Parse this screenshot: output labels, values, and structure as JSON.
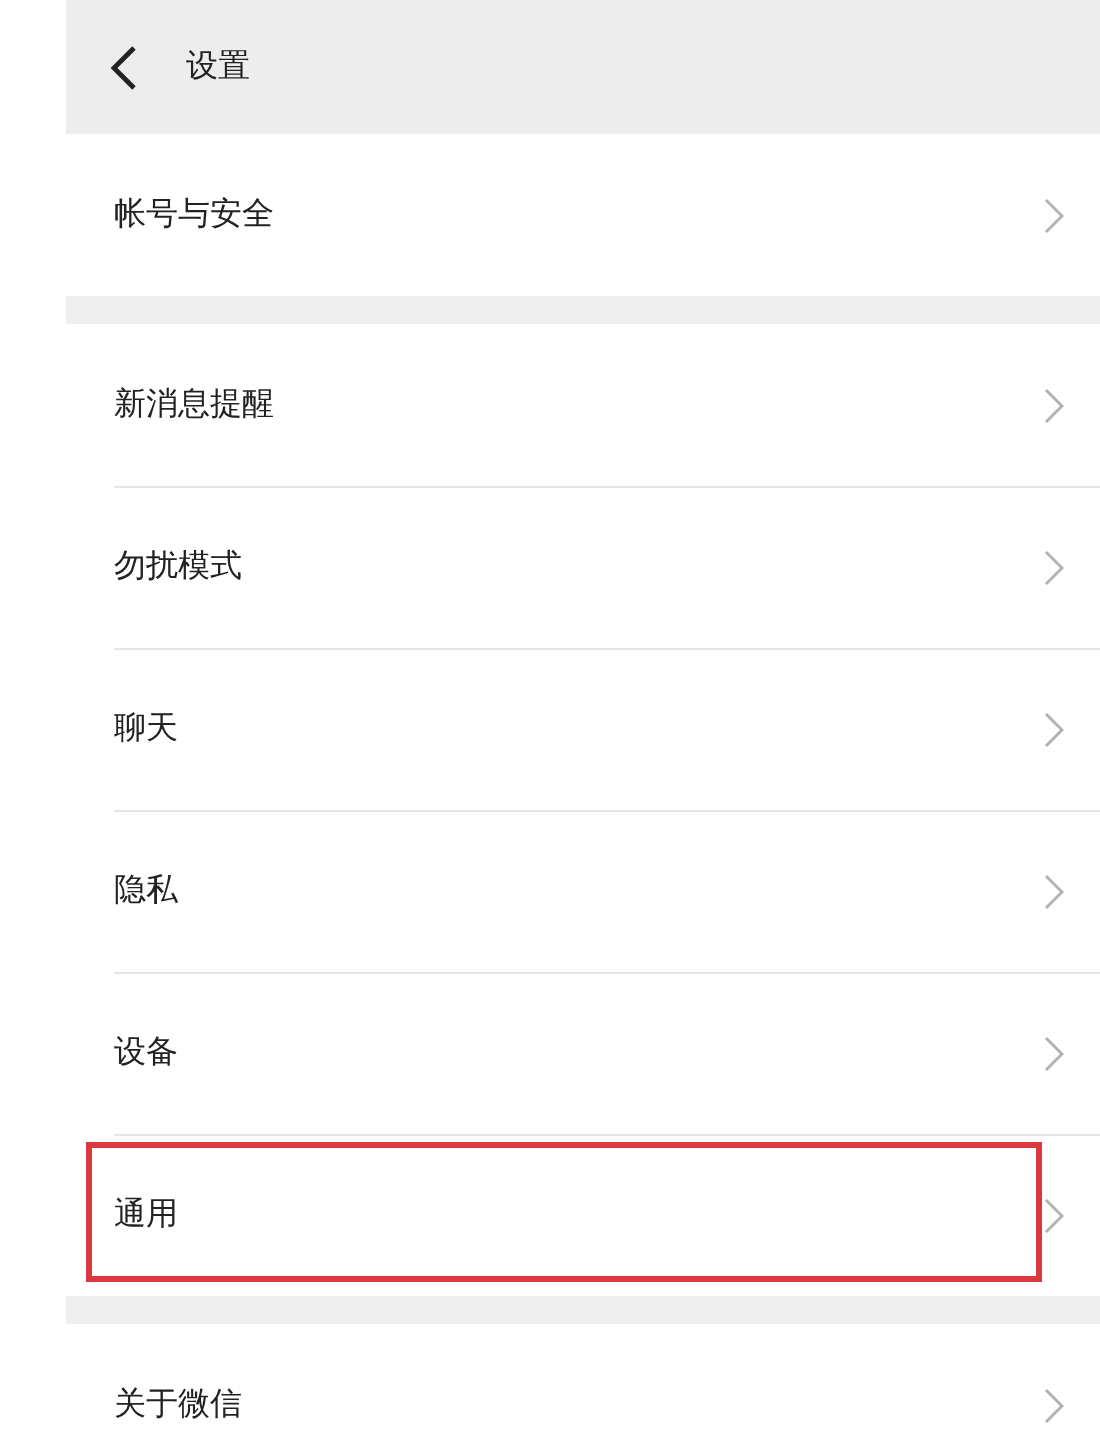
{
  "header": {
    "title": "设置"
  },
  "groups": [
    {
      "items": [
        {
          "label": "帐号与安全",
          "highlighted": false
        }
      ]
    },
    {
      "items": [
        {
          "label": "新消息提醒",
          "highlighted": false
        },
        {
          "label": "勿扰模式",
          "highlighted": false
        },
        {
          "label": "聊天",
          "highlighted": false
        },
        {
          "label": "隐私",
          "highlighted": false
        },
        {
          "label": "设备",
          "highlighted": false
        },
        {
          "label": "通用",
          "highlighted": true
        }
      ]
    },
    {
      "items": [
        {
          "label": "关于微信",
          "highlighted": false
        }
      ]
    }
  ]
}
